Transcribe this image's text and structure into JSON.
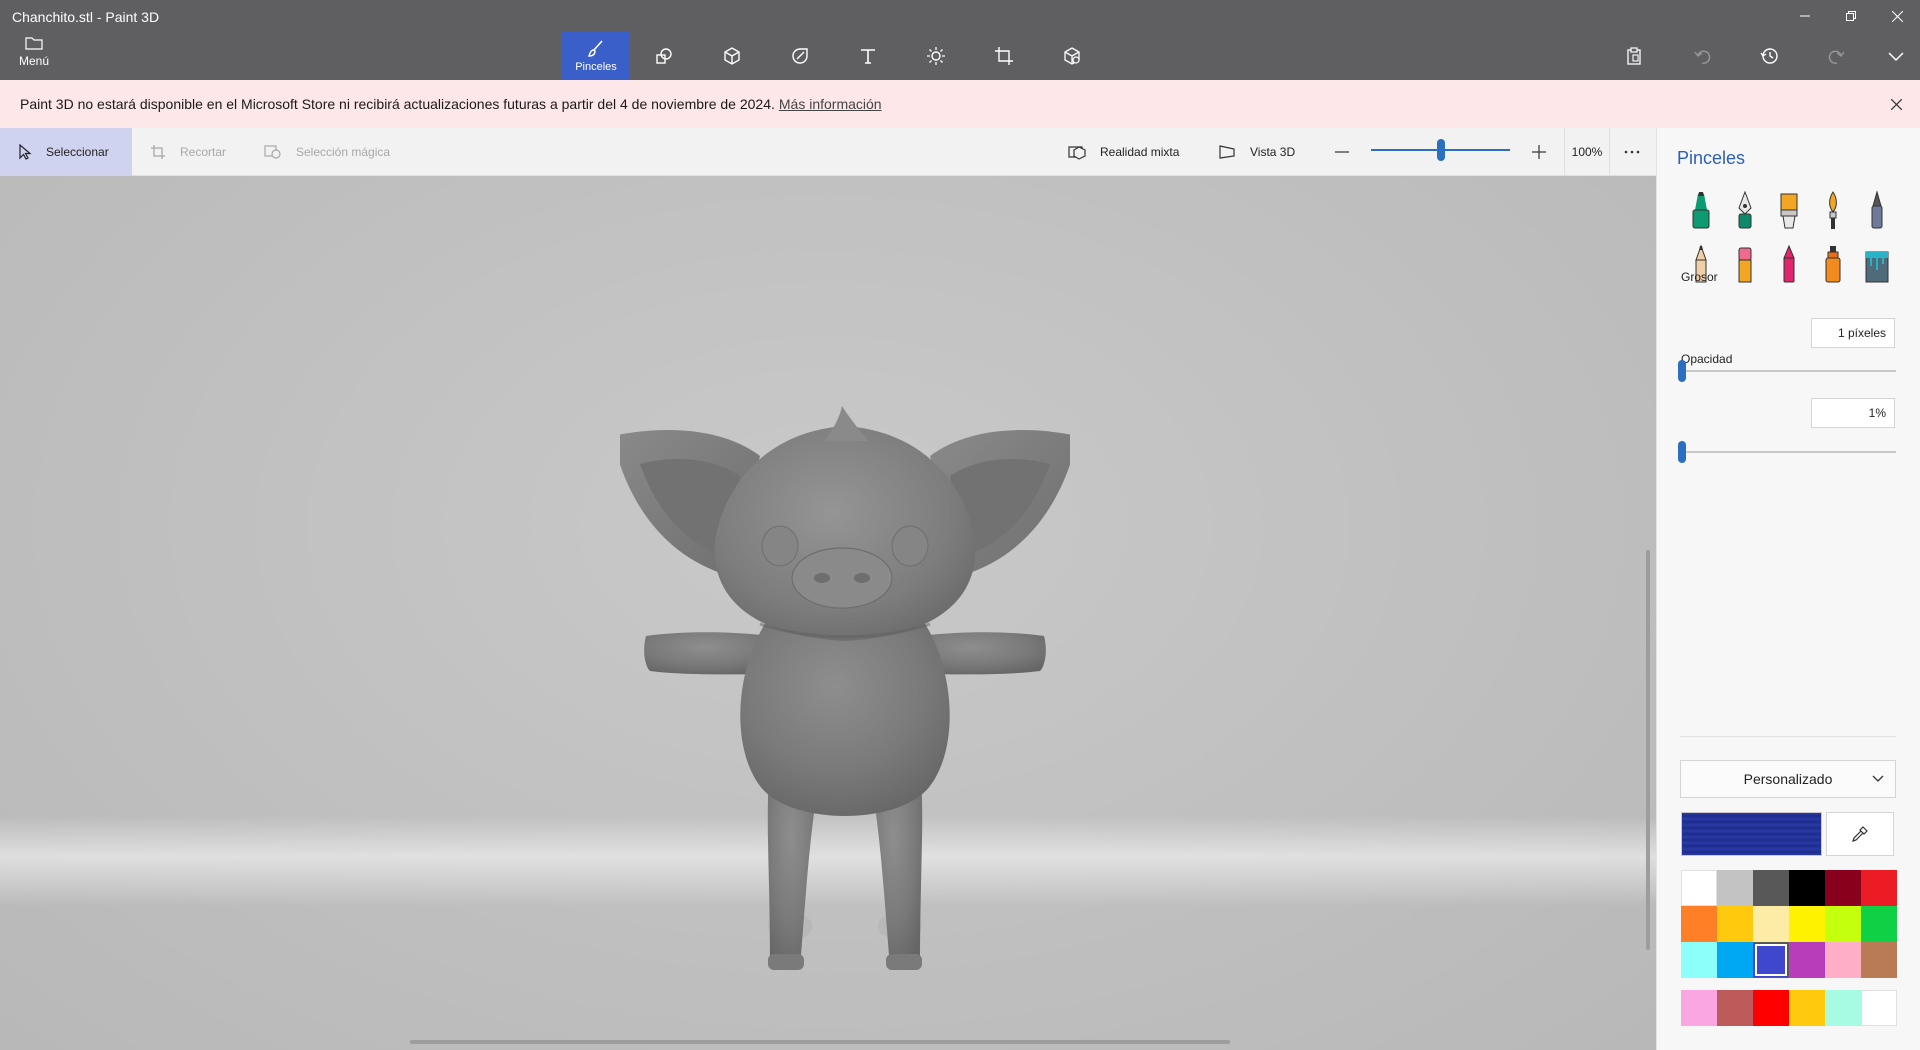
{
  "window": {
    "title": "Chanchito.stl - Paint 3D"
  },
  "menu": {
    "label": "Menú"
  },
  "toolbar": {
    "tools": [
      {
        "name": "brushes",
        "label": "Pinceles",
        "icon": "brush-icon",
        "active": true
      },
      {
        "name": "2d-shapes",
        "icon": "2d-shapes-icon"
      },
      {
        "name": "3d-shapes",
        "icon": "3d-shapes-icon"
      },
      {
        "name": "stickers",
        "icon": "stickers-icon"
      },
      {
        "name": "text",
        "icon": "text-icon"
      },
      {
        "name": "effects",
        "icon": "effects-icon"
      },
      {
        "name": "canvas",
        "icon": "canvas-icon"
      },
      {
        "name": "3d-library",
        "icon": "3d-library-icon"
      }
    ],
    "right_tools": [
      "paste-icon",
      "undo-icon",
      "history-icon",
      "redo-icon",
      "expand-icon"
    ]
  },
  "notice": {
    "text": "Paint 3D no estará disponible en el Microsoft Store ni recibirá actualizaciones futuras a partir del 4 de noviembre de 2024.",
    "link": "Más información"
  },
  "subbar": {
    "select": "Seleccionar",
    "crop": "Recortar",
    "magic_select": "Selección mágica",
    "mixed_reality": "Realidad mixta",
    "view_3d": "Vista 3D",
    "zoom": "100%",
    "zoom_level": 0.5
  },
  "panel": {
    "title": "Pinceles",
    "brushes": [
      "marker",
      "calligraphy-pen",
      "oil-brush",
      "watercolor",
      "pixel-pen",
      "pencil",
      "eraser",
      "crayon",
      "spray-can",
      "fill"
    ],
    "thickness_label": "Grosor",
    "thickness_value": "1 píxeles",
    "thickness_level": 0.01,
    "opacity_label": "Opacidad",
    "opacity_value": "1%",
    "opacity_level": 0.01,
    "palette_name": "Personalizado",
    "current_color": "#2a3aa8",
    "palette": [
      "#ffffff",
      "#c3c3c3",
      "#585858",
      "#000000",
      "#88001b",
      "#ec1c24",
      "#ff7f27",
      "#ffc90e",
      "#fdeca6",
      "#fff200",
      "#c4ff0e",
      "#0ed145",
      "#8cfffb",
      "#00a8f3",
      "#3f48cc",
      "#b83dba",
      "#ffaec8",
      "#b97a56"
    ],
    "selected_swatch": 14,
    "custom_colors": [
      "#f9a6e2",
      "#bd5a5a",
      "#ff0000",
      "#ffc90e",
      "#a8fbe3",
      "#ffffff"
    ]
  }
}
